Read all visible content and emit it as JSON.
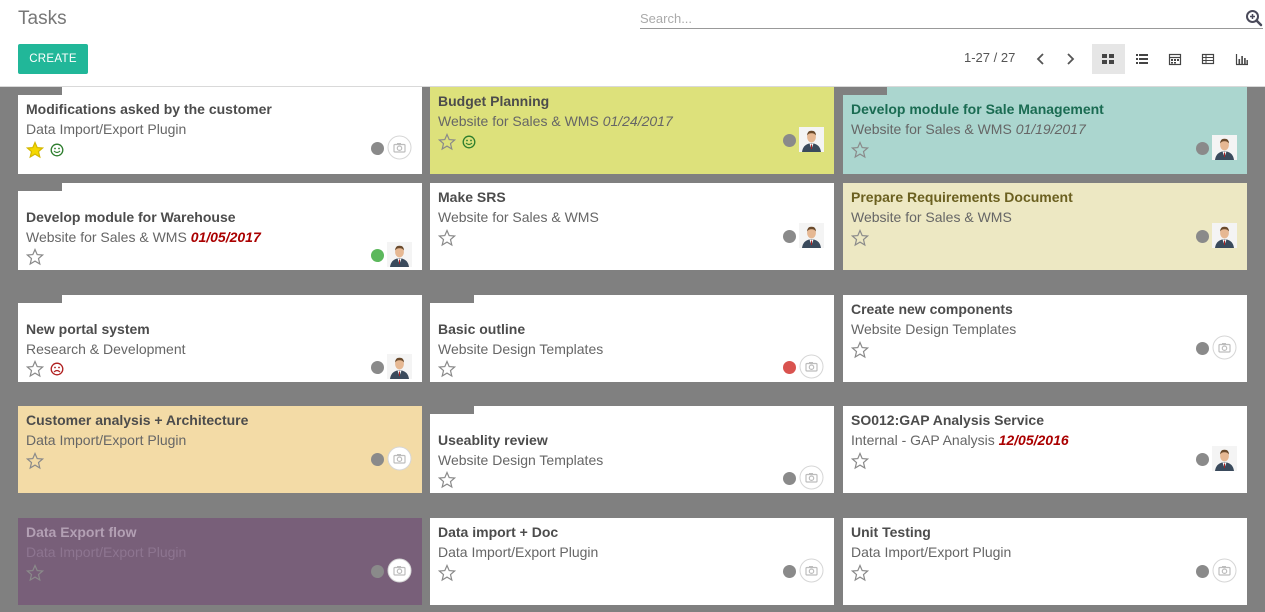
{
  "header": {
    "title": "Tasks",
    "search_placeholder": "Search...",
    "create_label": "CREATE",
    "pager": "1-27 / 27",
    "views": [
      "kanban-view-icon",
      "list-view-icon",
      "calendar-view-icon",
      "pivot-view-icon",
      "graph-view-icon"
    ]
  },
  "colors": {
    "primary": "#21b799",
    "board": "#808080",
    "state_grey": "#8a8a8a",
    "state_green": "#5cb85c",
    "state_red": "#d9534f",
    "star_gold": "#f5d800"
  },
  "cards": [
    {
      "name": "Modifications asked by the customer",
      "project": "Data Import/Export Plugin",
      "deadline": "",
      "starred": true,
      "mood": "happy",
      "state": "grey",
      "avatar": "placeholder"
    },
    {
      "name": "Budget Planning",
      "project": "Website for Sales & WMS",
      "deadline": "01/24/2017",
      "starred": false,
      "mood": "happy",
      "state": "grey",
      "avatar": "person"
    },
    {
      "name": "Develop module for Sale Management",
      "project": "Website for Sales & WMS",
      "deadline": "01/19/2017",
      "starred": false,
      "mood": "",
      "state": "grey",
      "avatar": "person"
    },
    {
      "name": "Develop module for Warehouse",
      "project": "Website for Sales & WMS",
      "deadline": "01/05/2017",
      "overdue": true,
      "starred": false,
      "mood": "",
      "state": "green",
      "avatar": "person"
    },
    {
      "name": "Make SRS",
      "project": "Website for Sales & WMS",
      "deadline": "",
      "starred": false,
      "mood": "",
      "state": "grey",
      "avatar": "person"
    },
    {
      "name": "Prepare Requirements Document",
      "project": "Website for Sales & WMS",
      "deadline": "",
      "starred": false,
      "mood": "",
      "state": "grey",
      "avatar": "person"
    },
    {
      "name": "New portal system",
      "project": "Research & Development",
      "deadline": "",
      "starred": false,
      "mood": "sad",
      "state": "grey",
      "avatar": "person"
    },
    {
      "name": "Basic outline",
      "project": "Website Design Templates",
      "deadline": "",
      "starred": false,
      "mood": "",
      "state": "red",
      "avatar": "placeholder"
    },
    {
      "name": "Create new components",
      "project": "Website Design Templates",
      "deadline": "",
      "starred": false,
      "mood": "",
      "state": "grey",
      "avatar": "placeholder"
    },
    {
      "name": "Customer analysis + Architecture",
      "project": "Data Import/Export Plugin",
      "deadline": "",
      "starred": false,
      "mood": "",
      "state": "grey",
      "avatar": "placeholder"
    },
    {
      "name": "Useablity review",
      "project": "Website Design Templates",
      "deadline": "",
      "starred": false,
      "mood": "",
      "state": "grey",
      "avatar": "placeholder"
    },
    {
      "name": "SO012:GAP Analysis Service",
      "project": "Internal - GAP Analysis",
      "deadline": "12/05/2016",
      "overdue": true,
      "starred": false,
      "mood": "",
      "state": "grey",
      "avatar": "person"
    },
    {
      "name": "Data Export flow",
      "project": "Data Import/Export Plugin",
      "deadline": "",
      "starred": false,
      "mood": "",
      "state": "grey",
      "avatar": "placeholder"
    },
    {
      "name": "Data import + Doc",
      "project": "Data Import/Export Plugin",
      "deadline": "",
      "starred": false,
      "mood": "",
      "state": "grey",
      "avatar": "placeholder"
    },
    {
      "name": "Unit Testing",
      "project": "Data Import/Export Plugin",
      "deadline": "",
      "starred": false,
      "mood": "",
      "state": "grey",
      "avatar": "placeholder"
    }
  ]
}
